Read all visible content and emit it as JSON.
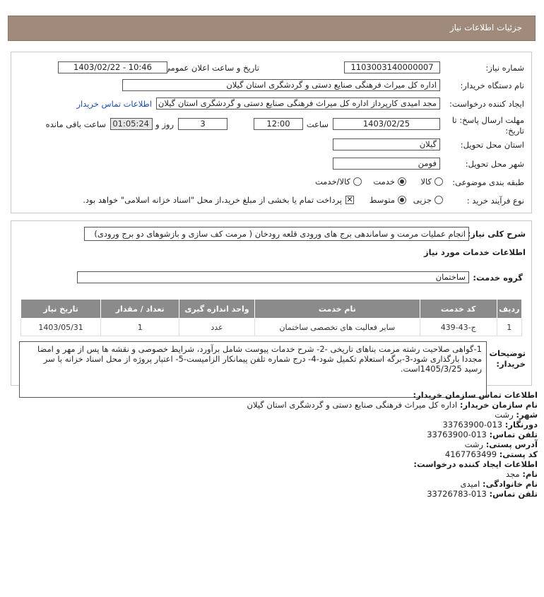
{
  "header": {
    "title": "جزئیات اطلاعات نیاز"
  },
  "form": {
    "need_number_label": "شماره نیاز:",
    "need_number": "1103003140000007",
    "announce_label": "تاریخ و ساعت اعلان عمومی:",
    "announce_value": "1403/02/22 - 10:46",
    "buyer_label": "نام دستگاه خریدار:",
    "buyer_value": "اداره کل میراث فرهنگی  صنایع دستی و گردشگری استان گیلان",
    "creator_label": "ایجاد کننده درخواست:",
    "creator_value": "مجد امیدی کارپرداز اداره کل میراث فرهنگی  صنایع دستی و گردشگری استان گیلان",
    "contact_link": "اطلاعات تماس خریدار",
    "deadline_label_1": "مهلت ارسال پاسخ: تا",
    "deadline_label_2": "تاریخ:",
    "deadline_date": "1403/02/25",
    "time_label": "ساعت",
    "deadline_time": "12:00",
    "days_value": "3",
    "days_label": "روز و",
    "remaining_time": "01:05:24",
    "remaining_label": "ساعت باقی مانده",
    "province_label": "استان محل تحویل:",
    "province_value": "گیلان",
    "city_label": "شهر محل تحویل:",
    "city_value": "فومن",
    "category_label": "طبقه بندی موضوعی:",
    "category_options": [
      "کالا",
      "خدمت",
      "کالا/خدمت"
    ],
    "process_label": "نوع فرآیند خرید :",
    "process_options": [
      "جزیی",
      "متوسط"
    ],
    "payment_note": "پرداخت تمام یا بخشی از مبلغ خرید،از محل \"اسناد خزانه اسلامی\" خواهد بود."
  },
  "summary": {
    "label": "شرح کلی نیاز:",
    "value": "انجام عملیات مرمت و ساماندهی برج های ورودی قلعه رودخان ( مرمت کف سازی و بازشوهای دو برج ورودی)"
  },
  "services": {
    "section_title": "اطلاعات خدمات مورد نیاز",
    "group_label": "گروه خدمت:",
    "group_value": "ساختمان",
    "columns": [
      "ردیف",
      "کد خدمت",
      "نام خدمت",
      "واحد اندازه گیری",
      "تعداد / مقدار",
      "تاریخ نیاز"
    ],
    "rows": [
      [
        "1",
        "ج-43-439",
        "سایر فعالیت های تخصصی ساختمان",
        "عدد",
        "1",
        "1403/05/31"
      ]
    ]
  },
  "notes": {
    "label_1": "توضیحات",
    "label_2": "خریدار:",
    "text": "1-گواهی صلاحیت رشته مرمت بناهای تاریخی -2- شرح خدمات پیوست شامل برآورد، شرایط خصوصی و نقشه ها پس از مهر و امضا مجددا بارگذاری شود-3-برگه استعلام تکمیل شود-4- درج شماره تلفن پیمانکار الزامیست-5- اعتبار پروژه از محل اسناد خزانه با سر رسید 1405/3/25است."
  },
  "contact": {
    "title": "اطلاعات تماس سازمان خریدار:",
    "org_label": "نام سازمان خریدار:",
    "org_value": "اداره کل میراث فرهنگی صنایع دستی و گردشگری استان گیلان",
    "city_label": "شهر:",
    "city_value": "رشت",
    "fax_label": "دورنگار:",
    "fax_value": "013-33763900",
    "phone_label": "تلفن تماس:",
    "phone_value": "013-33763900",
    "address_label": "آدرس پستی:",
    "address_value": "رشت",
    "postal_label": "کد پستی:",
    "postal_value": "4167763499",
    "creator_title": "اطلاعات ایجاد کننده درخواست:",
    "name_label": "نام:",
    "name_value": "مجد",
    "family_label": "نام خانوادگی:",
    "family_value": "امیدی",
    "creator_phone_label": "تلفن تماس:",
    "creator_phone_value": "013-33726783"
  }
}
